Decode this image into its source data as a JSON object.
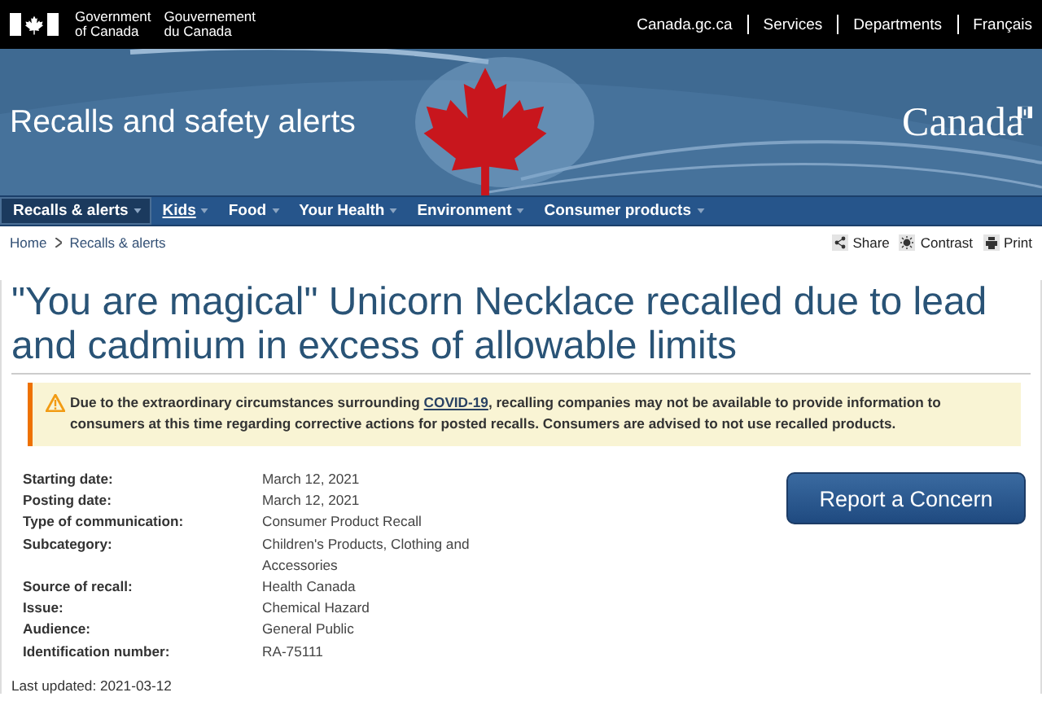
{
  "header": {
    "signature_en": [
      "Government",
      "of Canada"
    ],
    "signature_fr": [
      "Gouvernement",
      "du Canada"
    ],
    "links": [
      "Canada.gc.ca",
      "Services",
      "Departments",
      "Français"
    ]
  },
  "banner": {
    "title": "Recalls and safety alerts",
    "wordmark": "Canada"
  },
  "nav": [
    {
      "label": "Recalls & alerts",
      "selected": true,
      "hovered": false
    },
    {
      "label": "Kids",
      "selected": false,
      "hovered": true
    },
    {
      "label": "Food",
      "selected": false,
      "hovered": false
    },
    {
      "label": "Your Health",
      "selected": false,
      "hovered": false
    },
    {
      "label": "Environment",
      "selected": false,
      "hovered": false
    },
    {
      "label": "Consumer products",
      "selected": false,
      "hovered": false
    }
  ],
  "breadcrumb": [
    "Home",
    "Recalls & alerts"
  ],
  "tools": [
    {
      "kind": "share",
      "label": "Share"
    },
    {
      "kind": "contrast",
      "label": "Contrast"
    },
    {
      "kind": "print",
      "label": "Print"
    }
  ],
  "title": "\"You are magical\" Unicorn Necklace recalled due to lead and cadmium in excess of allowable limits",
  "alert": {
    "before": "Due to the extraordinary circumstances surrounding ",
    "link": "COVID-19",
    "after": ", recalling companies may not be available to provide information to consumers at this time regarding corrective actions for posted recalls. Consumers are advised to not use recalled products."
  },
  "details": [
    {
      "label": "Starting date:",
      "value": "March 12, 2021"
    },
    {
      "label": "Posting date:",
      "value": "March 12, 2021"
    },
    {
      "label": "Type of communication:",
      "value": "Consumer Product Recall"
    },
    {
      "label": "Subcategory:",
      "value": "Children's Products, Clothing and Accessories"
    },
    {
      "label": "Source of recall:",
      "value": "Health Canada"
    },
    {
      "label": "Issue:",
      "value": "Chemical Hazard"
    },
    {
      "label": "Audience:",
      "value": "General Public"
    },
    {
      "label": "Identification number:",
      "value": "RA-75111"
    }
  ],
  "report_button": "Report a Concern",
  "last_updated": "Last updated: 2021-03-12"
}
